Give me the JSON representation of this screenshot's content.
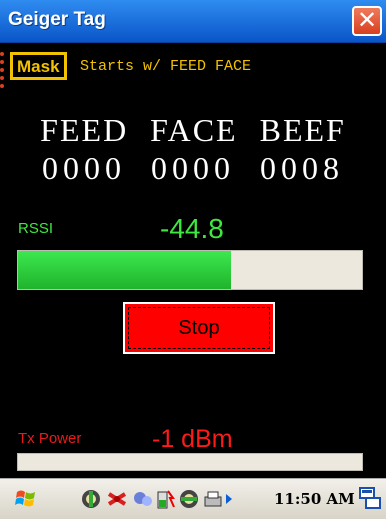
{
  "window": {
    "title": "Geiger Tag",
    "close_glyph": "✕"
  },
  "mask": {
    "button_label": "Mask",
    "description": "Starts w/ FEED FACE",
    "row1": "FEED FACE BEEF",
    "row2": "0000 0000 0008"
  },
  "rssi": {
    "label": "RSSI",
    "value": "-44.8",
    "bar_fraction": 0.62
  },
  "stop_button": {
    "label": "Stop"
  },
  "tx_power": {
    "label": "Tx Power",
    "value": "-1 dBm",
    "bar_fraction": 0
  },
  "taskbar": {
    "clock": "11:50 AM",
    "icons": [
      "start-flag-icon",
      "connectivity-icon",
      "bluetooth-icon",
      "sync-icon",
      "battery-icon",
      "globe-icon",
      "printer-icon",
      "tray-expand-arrow",
      "keyboard-icon"
    ]
  },
  "colors": {
    "title_bar": "#1f6fe0",
    "mask_text": "#f2c200",
    "rssi_green": "#3ee83e",
    "tx_red": "#ff1a1a",
    "stop_red": "#ff0000"
  }
}
